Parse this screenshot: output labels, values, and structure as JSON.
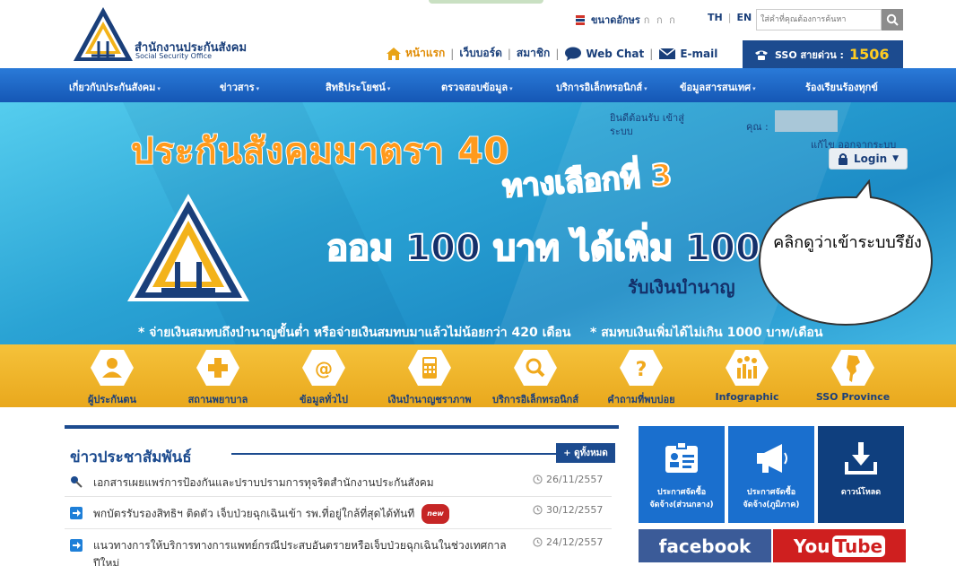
{
  "header": {
    "logo_th": "สำนักงานประกันสังคม",
    "logo_en": "Social Security Office",
    "font_size_label": "ขนาดอักษร",
    "font_size_options": "ก ก ก",
    "lang_th": "TH",
    "lang_en": "EN",
    "search_placeholder": "ใส่คำที่คุณต้องการค้นหา",
    "links": {
      "home": "หน้าแรก",
      "webboard": "เว็บบอร์ด",
      "member": "สมาชิก",
      "webchat": "Web Chat",
      "email": "E-mail"
    },
    "hotline_label": "SSO สายด่วน :",
    "hotline_number": "1506"
  },
  "nav": [
    "เกี่ยวกับประกันสังคม",
    "ข่าวสาร",
    "สิทธิประโยชน์",
    "ตรวจสอบข้อมูล",
    "บริการอิเล็กทรอนิกส์",
    "ข้อมูลสารสนเทศ",
    "ร้องเรียนร้องทุกข์"
  ],
  "banner": {
    "title": "ประกันสังคมมาตรา 40",
    "option": "ทางเลือกที่ 3",
    "save": "ออม 100 บาท ได้เพิ่ม 100",
    "pension": "รับเงินบำนาญ",
    "note_left": "* จ่ายเงินสมทบถึงบำนาญขั้นต่ำ หรือจ่ายเงินสมทบมาแล้วไม่น้อยกว่า 420 เดือน",
    "note_right": "* สมทบเงินเพิ่มได้ไม่เกิน 1000 บาท/เดือน"
  },
  "login": {
    "welcome": "ยินดีต้อนรับ เข้าสู่ระบบ",
    "user_label": "คุณ :",
    "account_links": "แก้ไข ออกจากระบบ",
    "button": "Login"
  },
  "callout": "คลิกดูว่าเข้าระบบรึยัง",
  "icon_bar": [
    "ผู้ประกันตน",
    "สถานพยาบาล",
    "ข้อมูลทั่วไป",
    "เงินบำนาญชราภาพ",
    "บริการอิเล็กทรอนิกส์",
    "คำถามที่พบบ่อย",
    "Infographic",
    "SSO Province"
  ],
  "news": {
    "title": "ข่าวประชาสัมพันธ์",
    "view_all": "+ ดูทั้งหมด",
    "items": [
      {
        "text": "เอกสารเผยแพร่การป้องกันและปราบปรามการทุจริตสำนักงานประกันสังคม",
        "date": "26/11/2557",
        "is_new": false
      },
      {
        "text": "พกบัตรรับรองสิทธิฯ ติดตัว เจ็บป่วยฉุกเฉินเข้า รพ.ที่อยู่ใกล้ที่สุดได้ทันที",
        "date": "30/12/2557",
        "is_new": true,
        "badge": "new"
      },
      {
        "text": "แนวทางการให้บริการทางการแพทย์กรณีประสบอันตรายหรือเจ็บป่วยฉุกเฉินในช่วงเทศกาล",
        "text2": "ปีใหม่",
        "date": "24/12/2557",
        "is_new": false
      }
    ]
  },
  "tiles": [
    {
      "label1": "ประกาศจัดซื้อ",
      "label2": "จัดจ้าง(ส่วนกลาง)"
    },
    {
      "label1": "ประกาศจัดซื้อ",
      "label2": "จัดจ้าง(ภูมิภาค)"
    },
    {
      "label1": "ดาวน์โหลด",
      "label2": ""
    }
  ],
  "social": {
    "facebook": "facebook",
    "youtube_you": "You",
    "youtube_tube": "Tube"
  },
  "colors": {
    "primary": "#1c4b8f",
    "nav": "#1f68c6",
    "accent": "#f5c23a",
    "hotline_number": "#ffcc22"
  }
}
